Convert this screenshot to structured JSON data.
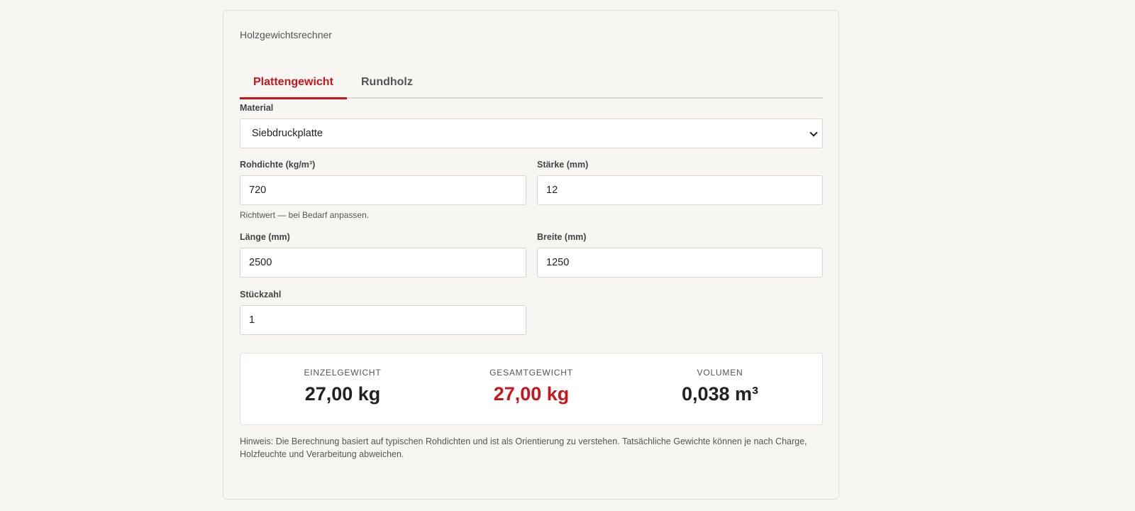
{
  "card": {
    "title": "Holzgewichtsrechner"
  },
  "tabs": [
    {
      "label": "Plattengewicht",
      "active": true
    },
    {
      "label": "Rundholz",
      "active": false
    }
  ],
  "form": {
    "material": {
      "label": "Material",
      "value": "Siebdruckplatte"
    },
    "density": {
      "label": "Rohdichte (kg/m³)",
      "value": "720",
      "hint": "Richtwert — bei Bedarf anpassen."
    },
    "thickness": {
      "label": "Stärke (mm)",
      "value": "12"
    },
    "length": {
      "label": "Länge (mm)",
      "value": "2500"
    },
    "width": {
      "label": "Breite (mm)",
      "value": "1250"
    },
    "quantity": {
      "label": "Stückzahl",
      "value": "1"
    }
  },
  "results": {
    "single": {
      "label": "EINZELGEWICHT",
      "value": "27,00 kg"
    },
    "total": {
      "label": "GESAMTGEWICHT",
      "value": "27,00 kg"
    },
    "volume": {
      "label": "VOLUMEN",
      "value": "0,038 m³"
    }
  },
  "note": "Hinweis: Die Berechnung basiert auf typischen Rohdichten und ist als Orientierung zu verstehen. Tatsächliche Gewichte können je nach Charge, Holzfeuchte und Verarbeitung abweichen.",
  "colors": {
    "accent": "#c8161d",
    "background": "#f7f6f3"
  }
}
